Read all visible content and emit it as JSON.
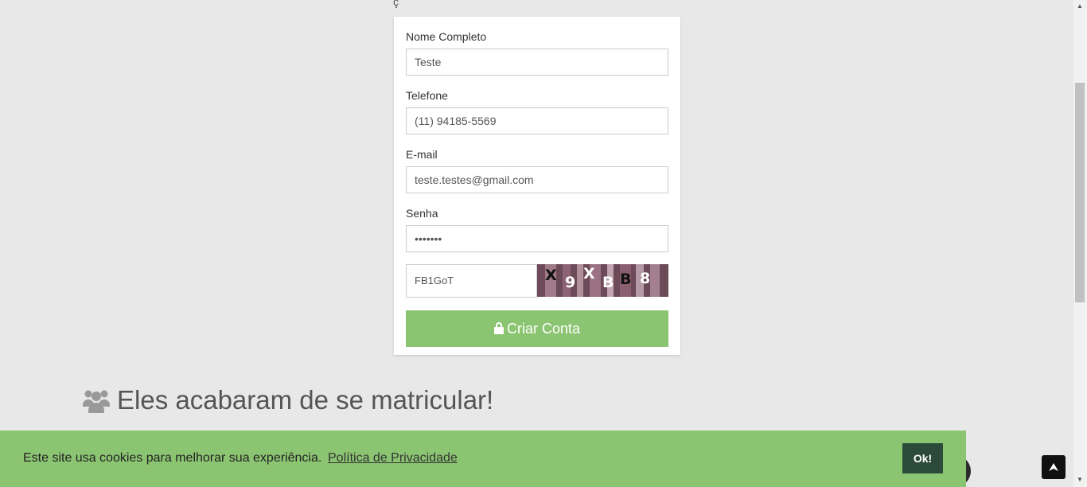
{
  "form": {
    "fields": [
      {
        "label": "Nome Completo",
        "value": "Teste"
      },
      {
        "label": "Telefone",
        "value": "(11) 94185-5569"
      },
      {
        "label": "E-mail",
        "value": "teste.testes@gmail.com"
      },
      {
        "label": "Senha",
        "value": "•••••••"
      }
    ],
    "captcha_value": "FB1GoT",
    "captcha_chars": [
      "X",
      "9",
      "X",
      "B",
      "B",
      "8"
    ],
    "submit_label": "Criar Conta"
  },
  "section": {
    "heading": "Eles acabaram de se matricular!"
  },
  "cookie": {
    "text": "Este site usa cookies para melhorar sua experiência.",
    "link": "Política de Privacidade",
    "ok": "Ok!"
  },
  "icons": {
    "submit": "lock-icon",
    "heading": "users-icon",
    "back_to_top": "arrow-up-icon"
  },
  "colors": {
    "accent_green": "#8cc572",
    "ok_button": "#2c4a3a",
    "background": "#e8e8e8"
  }
}
